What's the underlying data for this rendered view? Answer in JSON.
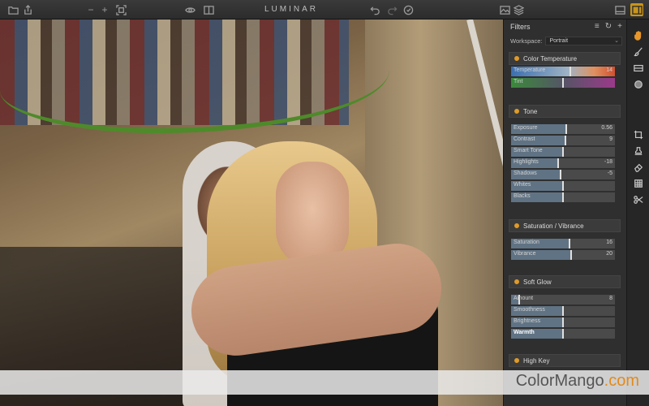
{
  "app": {
    "title": "LUMINAR"
  },
  "toolbar": {
    "icons": [
      "folder-icon",
      "share-icon",
      "zoom-out-icon",
      "zoom-in-icon",
      "fit-icon",
      "preview-eye-icon",
      "compare-icon",
      "undo-icon",
      "redo-icon",
      "history-icon",
      "image-browser-icon",
      "layers-icon",
      "panel-left-icon",
      "panel-right-icon"
    ],
    "zoom_out": "−",
    "zoom_in": "+"
  },
  "panel": {
    "title": "Filters",
    "workspace_label": "Workspace:",
    "workspace_value": "Portrait",
    "sections": [
      {
        "name": "Color Temperature",
        "sliders": [
          {
            "label": "Temperature",
            "value": "14",
            "level": 0.57
          },
          {
            "label": "Tint",
            "value": "",
            "level": 0.5
          }
        ]
      },
      {
        "name": "Tone",
        "sliders": [
          {
            "label": "Exposure",
            "value": "0.56",
            "level": 0.53
          },
          {
            "label": "Contrast",
            "value": "9",
            "level": 0.52
          },
          {
            "label": "Smart Tone",
            "value": "",
            "level": 0.5
          },
          {
            "label": "Highlights",
            "value": "-18",
            "level": 0.45
          },
          {
            "label": "Shadows",
            "value": "-5",
            "level": 0.48
          },
          {
            "label": "Whites",
            "value": "",
            "level": 0.5
          },
          {
            "label": "Blacks",
            "value": "",
            "level": 0.5
          }
        ]
      },
      {
        "name": "Saturation / Vibrance",
        "sliders": [
          {
            "label": "Saturation",
            "value": "16",
            "level": 0.56
          },
          {
            "label": "Vibrance",
            "value": "20",
            "level": 0.58
          }
        ]
      },
      {
        "name": "Soft Glow",
        "sliders": [
          {
            "label": "Amount",
            "value": "8",
            "level": 0.08
          },
          {
            "label": "Smoothness",
            "value": "",
            "level": 0.5
          },
          {
            "label": "Brightness",
            "value": "",
            "level": 0.5
          },
          {
            "label": "Warmth",
            "value": "",
            "level": 0.5
          }
        ]
      },
      {
        "name": "High Key",
        "sliders": []
      }
    ]
  },
  "tools": [
    "hand-icon",
    "brush-icon",
    "gradient-icon",
    "radial-icon",
    "crop-icon",
    "clone-stamp-icon",
    "eraser-icon",
    "transform-icon",
    "scissors-icon"
  ],
  "watermark": {
    "brand": "ColorMango",
    "suffix": ".com"
  },
  "colors": {
    "accent": "#e09a28",
    "panel": "#2f2f2f",
    "slider_fill": "#607384"
  }
}
